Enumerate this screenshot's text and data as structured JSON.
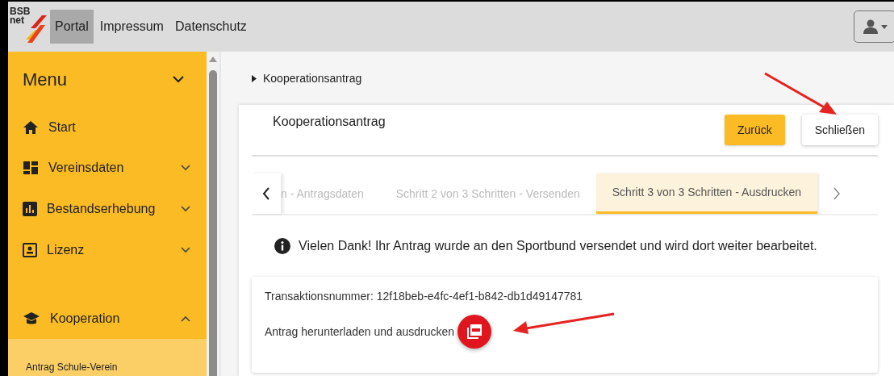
{
  "navbar": {
    "logo_lines": [
      "BSB",
      "net"
    ],
    "links": [
      {
        "label": "Portal",
        "selected": true
      },
      {
        "label": "Impressum",
        "selected": false
      },
      {
        "label": "Datenschutz",
        "selected": false
      }
    ]
  },
  "sidebar": {
    "title": "Menu",
    "expanded": true,
    "items": [
      {
        "label": "Start",
        "kind": "link"
      },
      {
        "label": "Vereinsdaten",
        "kind": "group",
        "expanded": false
      },
      {
        "label": "Bestandserhebung",
        "kind": "group",
        "expanded": false
      },
      {
        "label": "Lizenz",
        "kind": "group",
        "expanded": false
      },
      {
        "label": "Kooperation",
        "kind": "group",
        "expanded": true,
        "children": [
          {
            "label": "Antrag Schule-Verein"
          }
        ]
      }
    ]
  },
  "breadcrumb": "Kooperationsantrag",
  "card": {
    "title": "Kooperationsantrag",
    "buttons": [
      {
        "label": "Zurück",
        "kind": "primary"
      },
      {
        "label": "Schließen",
        "kind": "secondary"
      }
    ],
    "steps": [
      {
        "label": "n - Antragsdaten",
        "selected": false
      },
      {
        "label": "Schritt 2 von 3 Schritten - Versenden",
        "selected": false
      },
      {
        "label": "Schritt 3 von 3 Schritten - Ausdrucken",
        "selected": true
      }
    ],
    "message": "Vielen Dank! Ihr Antrag wurde an den Sportbund versendet und wird dort weiter bearbeitet.",
    "transaction": "Transaktionsnummer: 12f18beb-e4fc-4ef1-b842-db1d49147781",
    "download_label": "Antrag herunterladen und ausdrucken"
  }
}
